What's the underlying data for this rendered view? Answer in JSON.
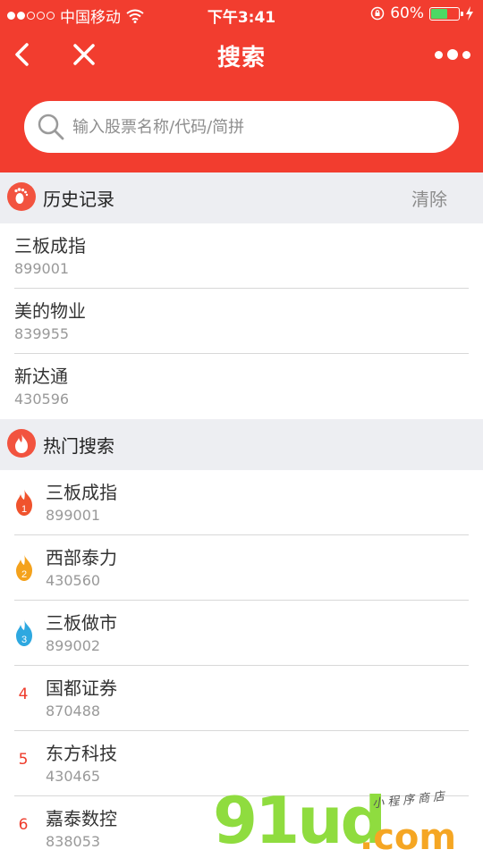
{
  "status_bar": {
    "carrier": "中国移动",
    "time": "下午3:41",
    "battery": "60%",
    "battery_level": 0.6
  },
  "nav": {
    "title": "搜索"
  },
  "search": {
    "placeholder": "输入股票名称/代码/简拼"
  },
  "history": {
    "title": "历史记录",
    "clear_label": "清除",
    "items": [
      {
        "name": "三板成指",
        "code": "899001"
      },
      {
        "name": "美的物业",
        "code": "839955"
      },
      {
        "name": "新达通",
        "code": "430596"
      }
    ]
  },
  "hot": {
    "title": "热门搜索",
    "items": [
      {
        "rank": "1",
        "name": "三板成指",
        "code": "899001",
        "flame_color": "#f0532d"
      },
      {
        "rank": "2",
        "name": "西部泰力",
        "code": "430560",
        "flame_color": "#f4a21c"
      },
      {
        "rank": "3",
        "name": "三板做市",
        "code": "899002",
        "flame_color": "#2ea8e0"
      },
      {
        "rank": "4",
        "name": "国都证券",
        "code": "870488"
      },
      {
        "rank": "5",
        "name": "东方科技",
        "code": "430465"
      },
      {
        "rank": "6",
        "name": "嘉泰数控",
        "code": "838053"
      }
    ]
  },
  "watermark": {
    "main": "91ud",
    "domain": ".com",
    "tagline": "小程序商店"
  },
  "colors": {
    "brand_red": "#f23d2f",
    "section_bg": "#edeef2"
  }
}
